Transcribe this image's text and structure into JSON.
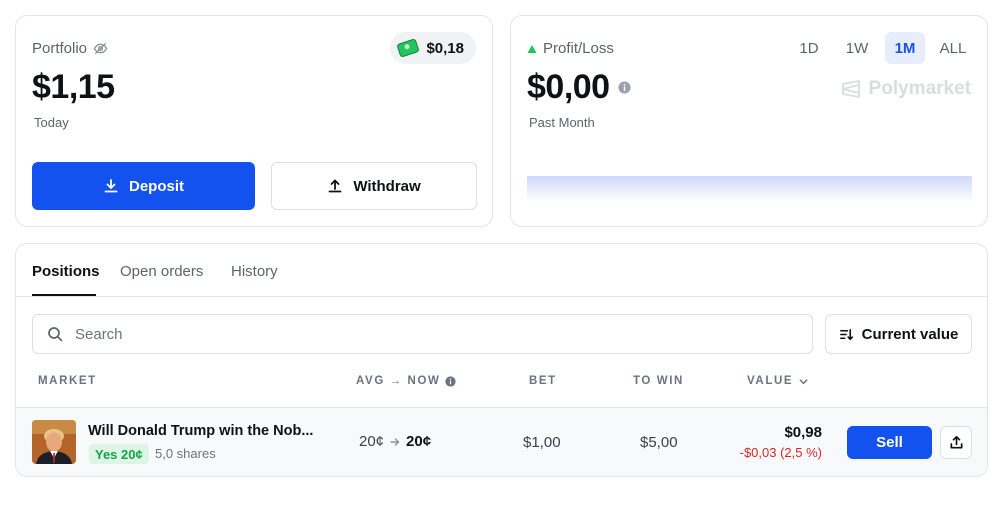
{
  "portfolio": {
    "label": "Portfolio",
    "cash": "$0,18",
    "value": "$1,15",
    "period": "Today",
    "deposit_label": "Deposit",
    "withdraw_label": "Withdraw"
  },
  "profit_loss": {
    "label": "Profit/Loss",
    "value": "$0,00",
    "period": "Past Month",
    "brand": "Polymarket",
    "ranges": [
      "1D",
      "1W",
      "1M",
      "ALL"
    ],
    "active_range": "1M"
  },
  "tabs": [
    "Positions",
    "Open orders",
    "History"
  ],
  "active_tab": "Positions",
  "search": {
    "placeholder": "Search"
  },
  "sort": {
    "label": "Current value"
  },
  "table": {
    "headers": {
      "market": "MARKET",
      "avg_now": "AVG → NOW",
      "bet": "BET",
      "to_win": "TO WIN",
      "value": "VALUE"
    },
    "rows": [
      {
        "title": "Will Donald Trump win the Nob...",
        "outcome": "Yes 20¢",
        "shares": "5,0 shares",
        "avg": "20¢",
        "now": "20¢",
        "bet": "$1,00",
        "to_win": "$5,00",
        "value": "$0,98",
        "change": "-$0,03 (2,5 %)",
        "sell_label": "Sell"
      }
    ]
  },
  "colors": {
    "primary": "#1452f0",
    "positive": "#16a34a",
    "negative": "#dc2626",
    "pl_arrow": "#22c55e"
  },
  "icons": [
    "eye-off-icon",
    "cash-icon",
    "download-icon",
    "upload-icon",
    "triangle-up-icon",
    "info-icon",
    "polymarket-logo-icon",
    "search-icon",
    "sort-icon",
    "arrow-right-icon",
    "chevron-down-icon",
    "share-icon"
  ]
}
